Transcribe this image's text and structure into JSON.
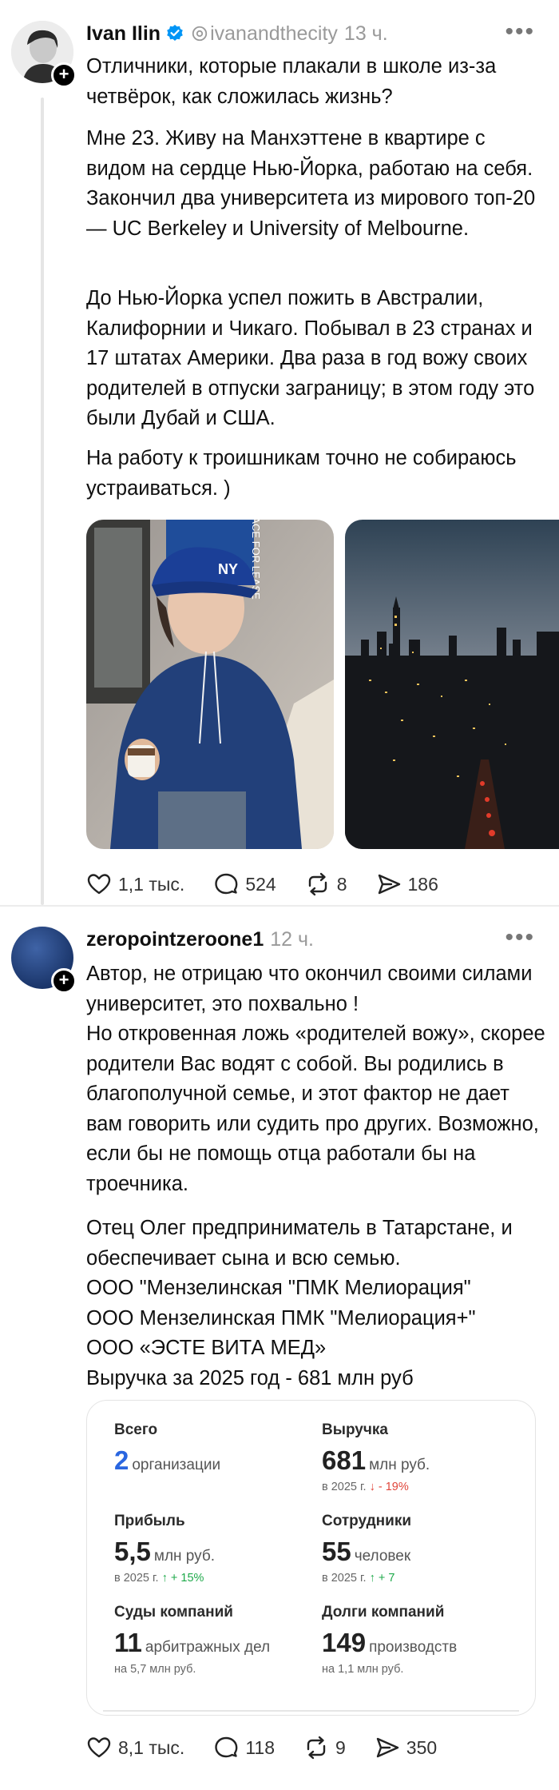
{
  "post1": {
    "author": "Ivan Ilin",
    "handle": "ivanandthecity",
    "time": "13 ч.",
    "paragraphs": [
      "Отличники, которые плакали в школе из-за четвёрок, как сложилась жизнь?",
      "Мне 23. Живу на Манхэттене в квартире с видом на сердце Нью-Йорка, работаю на себя. Закончил два университета из мирового топ-20 — UC Berkeley и University of Melbourne.",
      "До Нью-Йорка успел пожить в Австралии, Калифорнии и Чикаго. Побывал в 23 странах и 17 штатах Америки. Два раза в год вожу своих родителей в отпуски заграницу; в этом году это были Дубай и США.",
      "На работу к троишникам точно не собираюсь устраиваться. )"
    ],
    "photo_cap_text": "NY",
    "photo_sign_text": "SPACE FOR LEASE",
    "likes": "1,1 тыс.",
    "comments": "524",
    "reposts": "8",
    "shares": "186"
  },
  "post2": {
    "author": "zeropointzeroone1",
    "time": "12 ч.",
    "paragraphs": [
      "Автор, не отрицаю что окончил своими силами университет, это похвально !\nНо откровенная ложь «родителей вожу», скорее родители Вас водят с собой. Вы родились в благополучной семье, и этот фактор не дает вам говорить или судить про других. Возможно, если бы не помощь отца работали бы на троечника.",
      "Отец Олег предприниматель в Татарстане, и обеспечивает сына и всю семью.\nООО \"Мензелинская \"ПМК Мелиорация\"\nООО Мензелинская ПМК \"Мелиорация+\"\nООО «ЭСТЕ ВИТА МЕД»\nВыручка за 2025 год - 681 млн руб"
    ],
    "card": {
      "stats": [
        {
          "label": "Всего",
          "big": "2",
          "unit": "организации",
          "sub": "",
          "trend": "",
          "trend_dir": ""
        },
        {
          "label": "Выручка",
          "big": "681",
          "unit": "млн руб.",
          "sub": "в 2025 г.",
          "trend": "↓ - 19%",
          "trend_dir": "down"
        },
        {
          "label": "Прибыль",
          "big": "5,5",
          "unit": "млн руб.",
          "sub": "в 2025 г.",
          "trend": "↑ + 15%",
          "trend_dir": "up"
        },
        {
          "label": "Сотрудники",
          "big": "55",
          "unit": "человек",
          "sub": "в 2025 г.",
          "trend": "↑ + 7",
          "trend_dir": "up"
        },
        {
          "label": "Суды компаний",
          "big": "11",
          "unit": "арбитражных дел",
          "sub": "на 5,7 млн руб.",
          "trend": "",
          "trend_dir": ""
        },
        {
          "label": "Долги компаний",
          "big": "149",
          "unit": "производств",
          "sub": "на 1,1 млн руб.",
          "trend": "",
          "trend_dir": ""
        }
      ]
    },
    "likes": "8,1 тыс.",
    "comments": "118",
    "reposts": "9",
    "shares": "350"
  },
  "icons": [
    "more-icon",
    "verified-icon",
    "threads-icon",
    "heart-icon",
    "comment-icon",
    "repost-icon",
    "share-icon",
    "plus-icon"
  ],
  "colors": {
    "verified": "#0095f6",
    "blue_number": "#2a66e0",
    "down": "#e0453a",
    "up": "#1ea94a",
    "secondary_text": "#9a9a9a"
  }
}
